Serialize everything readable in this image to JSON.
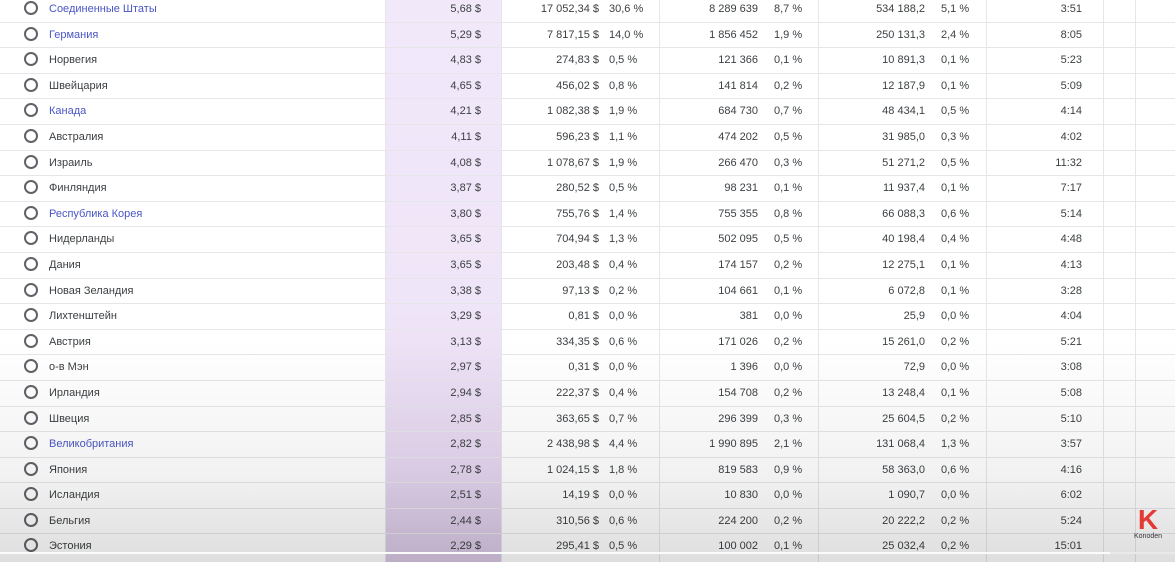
{
  "table": {
    "rows": [
      {
        "country": "Соединенные Штаты",
        "link": true,
        "rpm": "5,68 $",
        "revenue": "17 052,34 $",
        "revenue_pct": "30,6 %",
        "views": "8 289 639",
        "views_pct": "8,7 %",
        "watch_hours": "534 188,2",
        "watch_hours_pct": "5,1 %",
        "avg_duration": "3:51"
      },
      {
        "country": "Германия",
        "link": true,
        "rpm": "5,29 $",
        "revenue": "7 817,15 $",
        "revenue_pct": "14,0 %",
        "views": "1 856 452",
        "views_pct": "1,9 %",
        "watch_hours": "250 131,3",
        "watch_hours_pct": "2,4 %",
        "avg_duration": "8:05"
      },
      {
        "country": "Норвегия",
        "link": false,
        "rpm": "4,83 $",
        "revenue": "274,83 $",
        "revenue_pct": "0,5 %",
        "views": "121 366",
        "views_pct": "0,1 %",
        "watch_hours": "10 891,3",
        "watch_hours_pct": "0,1 %",
        "avg_duration": "5:23"
      },
      {
        "country": "Швейцария",
        "link": false,
        "rpm": "4,65 $",
        "revenue": "456,02 $",
        "revenue_pct": "0,8 %",
        "views": "141 814",
        "views_pct": "0,2 %",
        "watch_hours": "12 187,9",
        "watch_hours_pct": "0,1 %",
        "avg_duration": "5:09"
      },
      {
        "country": "Канада",
        "link": true,
        "rpm": "4,21 $",
        "revenue": "1 082,38 $",
        "revenue_pct": "1,9 %",
        "views": "684 730",
        "views_pct": "0,7 %",
        "watch_hours": "48 434,1",
        "watch_hours_pct": "0,5 %",
        "avg_duration": "4:14"
      },
      {
        "country": "Австралия",
        "link": false,
        "rpm": "4,11 $",
        "revenue": "596,23 $",
        "revenue_pct": "1,1 %",
        "views": "474 202",
        "views_pct": "0,5 %",
        "watch_hours": "31 985,0",
        "watch_hours_pct": "0,3 %",
        "avg_duration": "4:02"
      },
      {
        "country": "Израиль",
        "link": false,
        "rpm": "4,08 $",
        "revenue": "1 078,67 $",
        "revenue_pct": "1,9 %",
        "views": "266 470",
        "views_pct": "0,3 %",
        "watch_hours": "51 271,2",
        "watch_hours_pct": "0,5 %",
        "avg_duration": "11:32"
      },
      {
        "country": "Финляндия",
        "link": false,
        "rpm": "3,87 $",
        "revenue": "280,52 $",
        "revenue_pct": "0,5 %",
        "views": "98 231",
        "views_pct": "0,1 %",
        "watch_hours": "11 937,4",
        "watch_hours_pct": "0,1 %",
        "avg_duration": "7:17"
      },
      {
        "country": "Республика Корея",
        "link": true,
        "rpm": "3,80 $",
        "revenue": "755,76 $",
        "revenue_pct": "1,4 %",
        "views": "755 355",
        "views_pct": "0,8 %",
        "watch_hours": "66 088,3",
        "watch_hours_pct": "0,6 %",
        "avg_duration": "5:14"
      },
      {
        "country": "Нидерланды",
        "link": false,
        "rpm": "3,65 $",
        "revenue": "704,94 $",
        "revenue_pct": "1,3 %",
        "views": "502 095",
        "views_pct": "0,5 %",
        "watch_hours": "40 198,4",
        "watch_hours_pct": "0,4 %",
        "avg_duration": "4:48"
      },
      {
        "country": "Дания",
        "link": false,
        "rpm": "3,65 $",
        "revenue": "203,48 $",
        "revenue_pct": "0,4 %",
        "views": "174 157",
        "views_pct": "0,2 %",
        "watch_hours": "12 275,1",
        "watch_hours_pct": "0,1 %",
        "avg_duration": "4:13"
      },
      {
        "country": "Новая Зеландия",
        "link": false,
        "rpm": "3,38 $",
        "revenue": "97,13 $",
        "revenue_pct": "0,2 %",
        "views": "104 661",
        "views_pct": "0,1 %",
        "watch_hours": "6 072,8",
        "watch_hours_pct": "0,1 %",
        "avg_duration": "3:28"
      },
      {
        "country": "Лихтенштейн",
        "link": false,
        "rpm": "3,29 $",
        "revenue": "0,81 $",
        "revenue_pct": "0,0 %",
        "views": "381",
        "views_pct": "0,0 %",
        "watch_hours": "25,9",
        "watch_hours_pct": "0,0 %",
        "avg_duration": "4:04"
      },
      {
        "country": "Австрия",
        "link": false,
        "rpm": "3,13 $",
        "revenue": "334,35 $",
        "revenue_pct": "0,6 %",
        "views": "171 026",
        "views_pct": "0,2 %",
        "watch_hours": "15 261,0",
        "watch_hours_pct": "0,2 %",
        "avg_duration": "5:21"
      },
      {
        "country": "о-в Мэн",
        "link": false,
        "rpm": "2,97 $",
        "revenue": "0,31 $",
        "revenue_pct": "0,0 %",
        "views": "1 396",
        "views_pct": "0,0 %",
        "watch_hours": "72,9",
        "watch_hours_pct": "0,0 %",
        "avg_duration": "3:08"
      },
      {
        "country": "Ирландия",
        "link": false,
        "rpm": "2,94 $",
        "revenue": "222,37 $",
        "revenue_pct": "0,4 %",
        "views": "154 708",
        "views_pct": "0,2 %",
        "watch_hours": "13 248,4",
        "watch_hours_pct": "0,1 %",
        "avg_duration": "5:08"
      },
      {
        "country": "Швеция",
        "link": false,
        "rpm": "2,85 $",
        "revenue": "363,65 $",
        "revenue_pct": "0,7 %",
        "views": "296 399",
        "views_pct": "0,3 %",
        "watch_hours": "25 604,5",
        "watch_hours_pct": "0,2 %",
        "avg_duration": "5:10"
      },
      {
        "country": "Великобритания",
        "link": true,
        "rpm": "2,82 $",
        "revenue": "2 438,98 $",
        "revenue_pct": "4,4 %",
        "views": "1 990 895",
        "views_pct": "2,1 %",
        "watch_hours": "131 068,4",
        "watch_hours_pct": "1,3 %",
        "avg_duration": "3:57"
      },
      {
        "country": "Япония",
        "link": false,
        "rpm": "2,78 $",
        "revenue": "1 024,15 $",
        "revenue_pct": "1,8 %",
        "views": "819 583",
        "views_pct": "0,9 %",
        "watch_hours": "58 363,0",
        "watch_hours_pct": "0,6 %",
        "avg_duration": "4:16"
      },
      {
        "country": "Исландия",
        "link": false,
        "rpm": "2,51 $",
        "revenue": "14,19 $",
        "revenue_pct": "0,0 %",
        "views": "10 830",
        "views_pct": "0,0 %",
        "watch_hours": "1 090,7",
        "watch_hours_pct": "0,0 %",
        "avg_duration": "6:02"
      },
      {
        "country": "Бельгия",
        "link": false,
        "rpm": "2,44 $",
        "revenue": "310,56 $",
        "revenue_pct": "0,6 %",
        "views": "224 200",
        "views_pct": "0,2 %",
        "watch_hours": "20 222,2",
        "watch_hours_pct": "0,2 %",
        "avg_duration": "5:24"
      },
      {
        "country": "Эстония",
        "link": false,
        "rpm": "2,29 $",
        "revenue": "295,41 $",
        "revenue_pct": "0,5 %",
        "views": "100 002",
        "views_pct": "0,1 %",
        "watch_hours": "25 032,4",
        "watch_hours_pct": "0,2 %",
        "avg_duration": "15:01"
      }
    ]
  },
  "colors": {
    "link": "#4a56c6",
    "text": "#3c4043",
    "highlight": "#f1e8fa",
    "logo": "#e53935"
  },
  "watermark": {
    "mark": "K",
    "text": "Konoden"
  }
}
